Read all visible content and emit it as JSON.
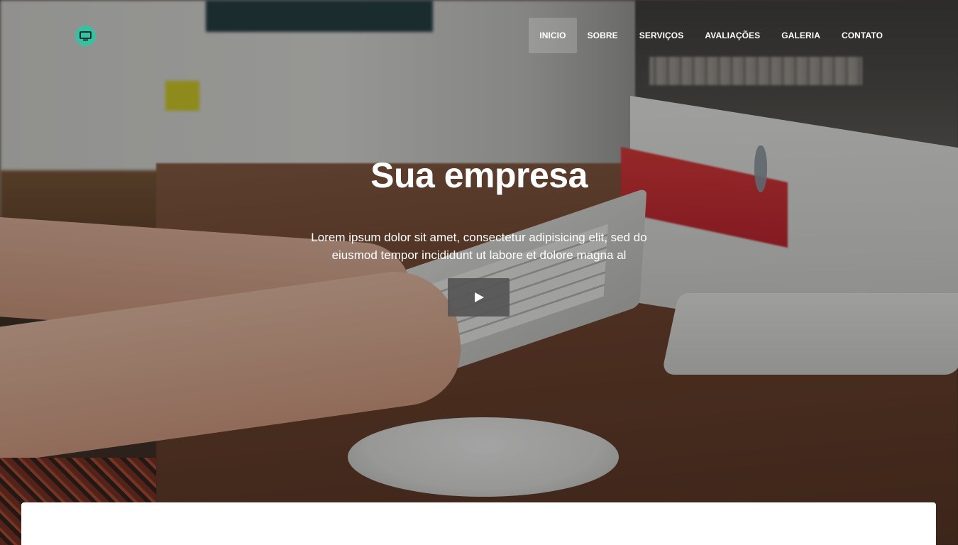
{
  "brand": {
    "logo_icon": "monitor-icon",
    "accent_color": "#36c2a2"
  },
  "nav": {
    "items": [
      {
        "label": "INICIO",
        "active": true
      },
      {
        "label": "SOBRE",
        "active": false
      },
      {
        "label": "SERVIÇOS",
        "active": false
      },
      {
        "label": "AVALIAÇÕES",
        "active": false
      },
      {
        "label": "GALERIA",
        "active": false
      },
      {
        "label": "CONTATO",
        "active": false
      }
    ]
  },
  "hero": {
    "title": "Sua empresa",
    "text": "Lorem ipsum dolor sit amet, consectetur adipisicing elit, sed do eiusmod tempor incididunt ut labore et dolore magna al",
    "play_icon": "play-icon"
  }
}
